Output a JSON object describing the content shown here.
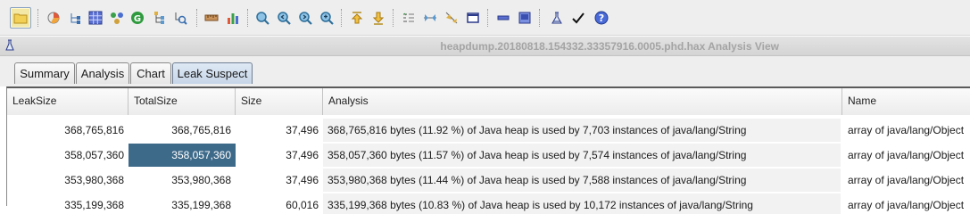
{
  "window": {
    "title": "heapdump.20180818.154332.33357916.0005.phd.hax Analysis View"
  },
  "toolbar": {
    "icons": [
      "open-folder-icon",
      "pie-chart-icon",
      "tree-icon",
      "grid-table-icon",
      "molecule-icon",
      "refresh-g-icon",
      "hierarchy-icon",
      "search-tree-icon",
      "ruler-icon",
      "bar-chart-icon",
      "zoom-icon",
      "zoom-prev-icon",
      "zoom-next-icon",
      "zoom-fit-icon",
      "arrow-up-icon",
      "arrow-down-icon",
      "filter-icon",
      "collapse-icon",
      "expand-icon",
      "window-icon",
      "minimize-icon",
      "restore-icon",
      "flask-icon",
      "checkmark-icon",
      "help-icon"
    ]
  },
  "tabs": [
    {
      "label": "Summary"
    },
    {
      "label": "Analysis"
    },
    {
      "label": "Chart"
    },
    {
      "label": "Leak Suspect"
    }
  ],
  "table": {
    "columns": [
      "LeakSize",
      "TotalSize",
      "Size",
      "Analysis",
      "Name"
    ],
    "rows": [
      {
        "leak_size": "368,765,816",
        "total_size": "368,765,816",
        "size": "37,496",
        "analysis": "368,765,816 bytes (11.92 %) of Java heap is used by 7,703 instances of java/lang/String",
        "name": "array of java/lang/Object"
      },
      {
        "leak_size": "358,057,360",
        "total_size": "358,057,360",
        "size": "37,496",
        "analysis": "358,057,360 bytes (11.57 %) of Java heap is used by 7,574 instances of java/lang/String",
        "name": "array of java/lang/Object"
      },
      {
        "leak_size": "353,980,368",
        "total_size": "353,980,368",
        "size": "37,496",
        "analysis": "353,980,368 bytes (11.44 %) of Java heap is used by 7,588 instances of java/lang/String",
        "name": "array of java/lang/Object"
      },
      {
        "leak_size": "335,199,368",
        "total_size": "335,199,368",
        "size": "60,016",
        "analysis": "335,199,368 bytes (10.83 %) of Java heap is used by 10,172 instances of java/lang/String",
        "name": "array of java/lang/Object"
      }
    ]
  },
  "colors": {
    "selection": "#3e6a8a",
    "active_tab": "#c6d5e8",
    "toolbar_bg": "#eeeeee"
  }
}
